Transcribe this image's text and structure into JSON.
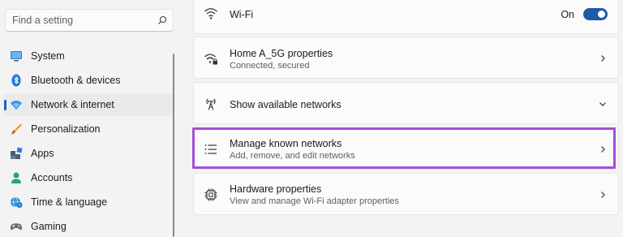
{
  "search": {
    "placeholder": "Find a setting"
  },
  "sidebar": {
    "items": [
      {
        "label": "System",
        "icon": "system-icon"
      },
      {
        "label": "Bluetooth & devices",
        "icon": "bluetooth-icon"
      },
      {
        "label": "Network & internet",
        "icon": "network-icon",
        "selected": true
      },
      {
        "label": "Personalization",
        "icon": "brush-icon"
      },
      {
        "label": "Apps",
        "icon": "apps-icon"
      },
      {
        "label": "Accounts",
        "icon": "accounts-icon"
      },
      {
        "label": "Time & language",
        "icon": "globe-clock-icon"
      },
      {
        "label": "Gaming",
        "icon": "gaming-icon"
      }
    ]
  },
  "main": {
    "wifi": {
      "title": "Wi-Fi",
      "state": "On",
      "on": true
    },
    "properties": {
      "title": "Home A_5G properties",
      "subtitle": "Connected, secured"
    },
    "available": {
      "title": "Show available networks"
    },
    "known": {
      "title": "Manage known networks",
      "subtitle": "Add, remove, and edit networks"
    },
    "hardware": {
      "title": "Hardware properties",
      "subtitle": "View and manage Wi-Fi adapter properties"
    }
  },
  "colors": {
    "accent": "#1d5aa8",
    "highlight": "#a24fd6"
  }
}
